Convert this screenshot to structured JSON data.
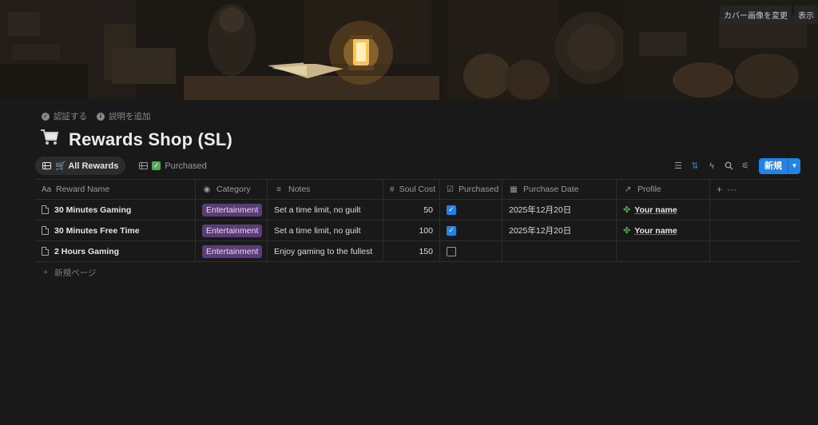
{
  "cover": {
    "buttons": [
      "カバー画像を変更",
      "表示"
    ]
  },
  "meta": {
    "verify_label": "認証する",
    "add_description_label": "説明を追加"
  },
  "page": {
    "icon": "shopping-cart-icon",
    "title": "Rewards Shop (SL)"
  },
  "views": [
    {
      "label": "🛒 All Rewards",
      "active": true
    },
    {
      "label": "Purchased",
      "active": false
    }
  ],
  "toolbar": {
    "new_label": "新規"
  },
  "table": {
    "columns": [
      "Reward Name",
      "Category",
      "Notes",
      "Soul Cost",
      "Purchased",
      "Purchase Date",
      "Profile"
    ],
    "rows": [
      {
        "name": "30 Minutes Gaming",
        "category": "Entertainment",
        "notes": "Set a time limit, no guilt",
        "cost": "50",
        "purchased": true,
        "date": "2025年12月20日",
        "profile": "Your name"
      },
      {
        "name": "30 Minutes Free Time",
        "category": "Entertainment",
        "notes": "Set a time limit, no guilt",
        "cost": "100",
        "purchased": true,
        "date": "2025年12月20日",
        "profile": "Your name"
      },
      {
        "name": "2 Hours Gaming",
        "category": "Entertainment",
        "notes": "Enjoy gaming to the fullest",
        "cost": "150",
        "purchased": false,
        "date": "",
        "profile": ""
      }
    ],
    "new_page_label": "新規ページ"
  },
  "colors": {
    "accent": "#2383e2",
    "tag_bg": "#5a3c76",
    "background": "#191919"
  }
}
